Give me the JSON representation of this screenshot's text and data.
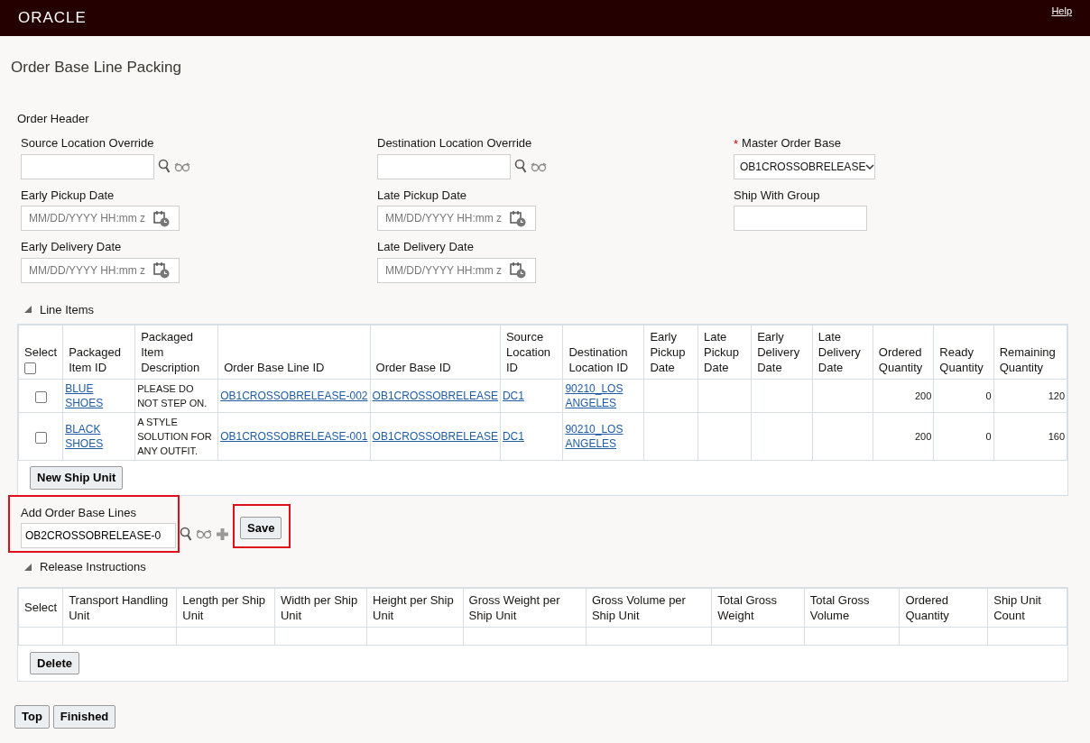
{
  "header": {
    "logo": "ORACLE",
    "help": "Help"
  },
  "page_title": "Order Base Line Packing",
  "order_header": {
    "title": "Order Header",
    "columns": [
      [
        {
          "kind": "lookup",
          "label": "Source Location Override"
        },
        {
          "kind": "date",
          "label": "Early Pickup Date",
          "placeholder": "MM/DD/YYYY HH:mm z"
        },
        {
          "kind": "date",
          "label": "Early Delivery Date",
          "placeholder": "MM/DD/YYYY HH:mm z"
        }
      ],
      [
        {
          "kind": "lookup",
          "label": "Destination Location Override"
        },
        {
          "kind": "date",
          "label": "Late Pickup Date",
          "placeholder": "MM/DD/YYYY HH:mm z"
        },
        {
          "kind": "date",
          "label": "Late Delivery Date",
          "placeholder": "MM/DD/YYYY HH:mm z"
        }
      ],
      [
        {
          "kind": "select",
          "label": "Master Order Base",
          "required": true,
          "required_mark": "*",
          "value": "OB1CROSSOBRELEASE"
        },
        {
          "kind": "text",
          "label": "Ship With Group"
        }
      ]
    ]
  },
  "line_items": {
    "title": "Line Items",
    "expanded": true,
    "select_all_checked": false,
    "columns": [
      {
        "label": "Select",
        "kind": "check"
      },
      {
        "label": "Packaged Item ID",
        "kind": "link"
      },
      {
        "label": "Packaged Item Description",
        "kind": "text"
      },
      {
        "label": "Order Base Line ID",
        "kind": "link"
      },
      {
        "label": "Order Base ID",
        "kind": "link"
      },
      {
        "label": "Source Location ID",
        "kind": "link"
      },
      {
        "label": "Destination Location ID",
        "kind": "link"
      },
      {
        "label": "Early Pickup Date",
        "kind": "text"
      },
      {
        "label": "Late Pickup Date",
        "kind": "text"
      },
      {
        "label": "Early Delivery Date",
        "kind": "text"
      },
      {
        "label": "Late Delivery Date",
        "kind": "text"
      },
      {
        "label": "Ordered Quantity",
        "kind": "number"
      },
      {
        "label": "Ready Quantity",
        "kind": "number"
      },
      {
        "label": "Remaining Quantity",
        "kind": "number"
      }
    ],
    "rows": [
      {
        "checked": false,
        "cells": [
          "",
          "BLUE SHOES",
          "PLEASE DO NOT STEP ON.",
          "OB1CROSSOBRELEASE-002",
          "OB1CROSSOBRELEASE",
          "DC1",
          "90210_LOS ANGELES",
          "",
          "",
          "",
          "",
          "200",
          "0",
          "120"
        ]
      },
      {
        "checked": false,
        "cells": [
          "",
          "BLACK SHOES",
          "A STYLE SOLUTION FOR ANY OUTFIT.",
          "OB1CROSSOBRELEASE-001",
          "OB1CROSSOBRELEASE",
          "DC1",
          "90210_LOS ANGELES",
          "",
          "",
          "",
          "",
          "200",
          "0",
          "160"
        ]
      }
    ],
    "button": "New Ship Unit"
  },
  "add_lines": {
    "label": "Add Order Base Lines",
    "value": "OB2CROSSOBRELEASE-0",
    "highlighted": true,
    "save": "Save",
    "save_highlighted": true
  },
  "release_instructions": {
    "title": "Release Instructions",
    "expanded": true,
    "columns": [
      "Select",
      "Transport Handling Unit",
      "Length per Ship Unit",
      "Width per Ship Unit",
      "Height per Ship Unit",
      "Gross Weight per Ship Unit",
      "Gross Volume per Ship Unit",
      "Total Gross Weight",
      "Total Gross Volume",
      "Ordered Quantity",
      "Ship Unit Count"
    ],
    "button": "Delete"
  },
  "footer_buttons": [
    "Top",
    "Finished"
  ]
}
